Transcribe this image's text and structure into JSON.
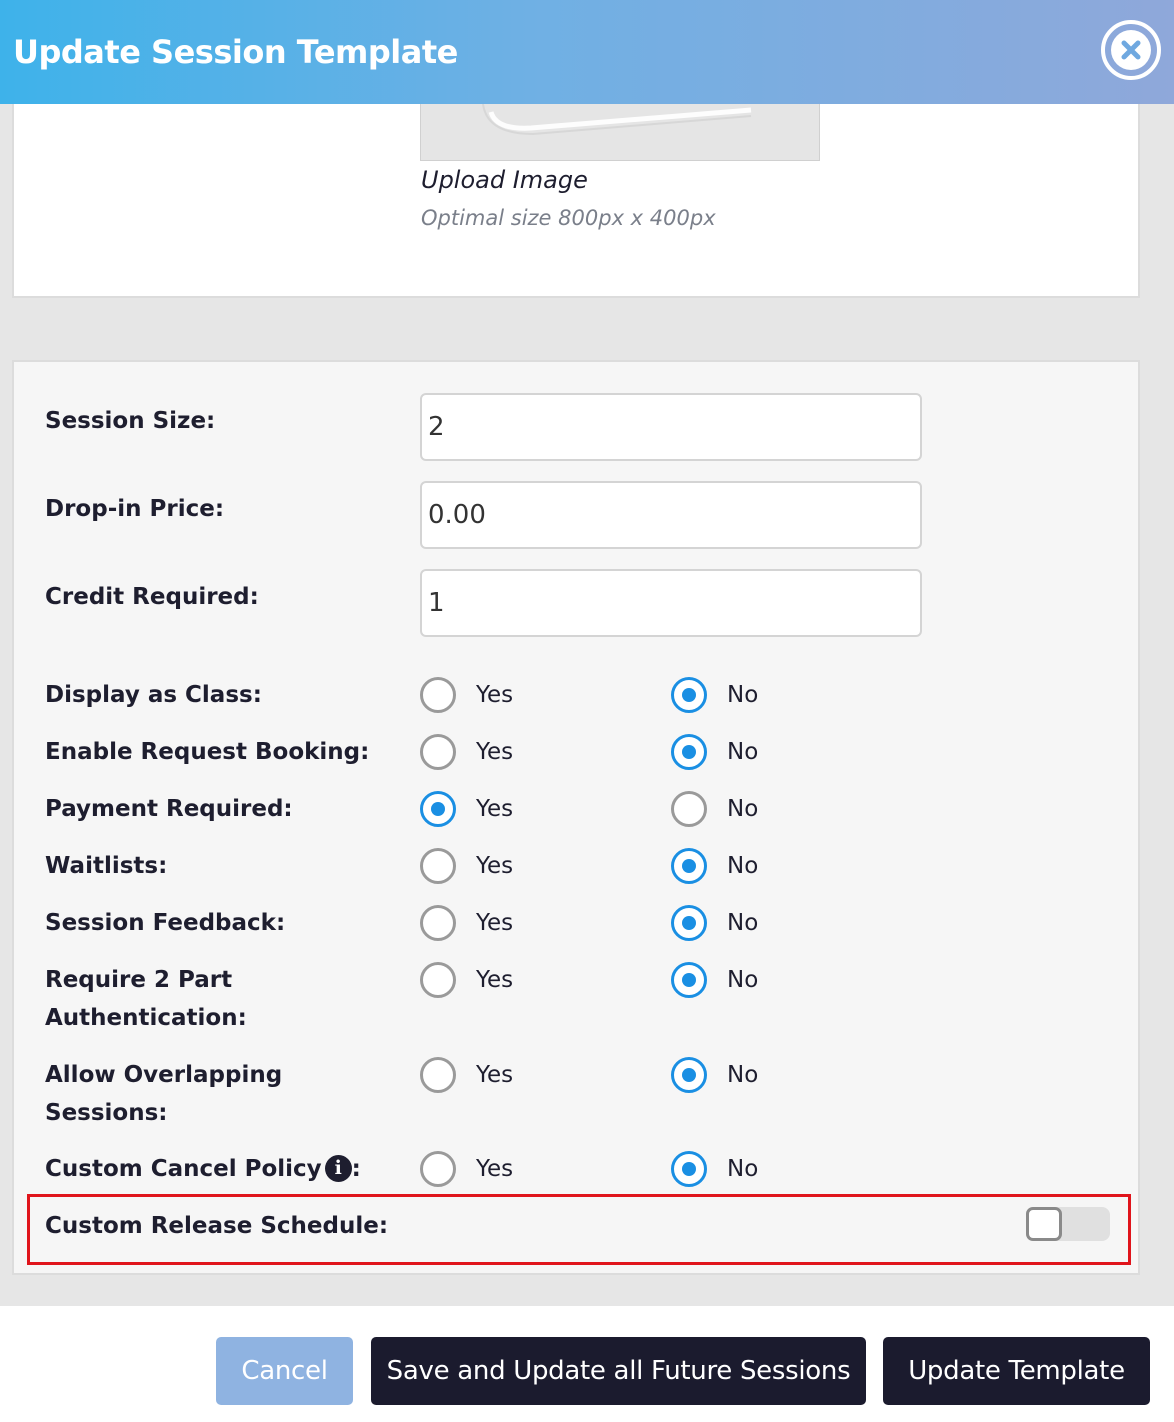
{
  "header": {
    "title": "Update Session Template",
    "close_icon": "close-icon"
  },
  "image_upload": {
    "link_label": "Upload Image",
    "hint": "Optimal size 800px x 400px"
  },
  "fields": {
    "session_size": {
      "label": "Session Size:",
      "value": "2"
    },
    "dropin_price": {
      "label": "Drop-in Price:",
      "value": "0.00"
    },
    "credit_required": {
      "label": "Credit Required:",
      "value": "1"
    }
  },
  "options": {
    "yes": "Yes",
    "no": "No",
    "display_as_class": {
      "label": "Display as Class:",
      "selected": "no"
    },
    "enable_request_booking": {
      "label": "Enable Request Booking:",
      "selected": "no"
    },
    "payment_required": {
      "label": "Payment Required:",
      "selected": "yes"
    },
    "waitlists": {
      "label": "Waitlists:",
      "selected": "no"
    },
    "session_feedback": {
      "label": "Session Feedback:",
      "selected": "no"
    },
    "require_2part_auth": {
      "label_line1": "Require 2 Part",
      "label_line2": "Authentication:",
      "selected": "no"
    },
    "allow_overlapping": {
      "label_line1": "Allow Overlapping",
      "label_line2": "Sessions:",
      "selected": "no"
    },
    "custom_cancel_policy": {
      "label": "Custom Cancel Policy",
      "label_suffix": ":",
      "info_glyph": "i",
      "selected": "no"
    }
  },
  "release_schedule": {
    "label": "Custom Release Schedule:",
    "enabled": false
  },
  "footer": {
    "cancel_label": "Cancel",
    "save_all_label": "Save and Update all Future Sessions",
    "update_label": "Update Template"
  },
  "colors": {
    "accent": "#1a8fe3",
    "header_start": "#3eb2ea",
    "header_end": "#8fa8da",
    "highlight": "#e0141b",
    "dark_button": "#1b1b2e",
    "cancel_button": "#8fb3e1"
  }
}
